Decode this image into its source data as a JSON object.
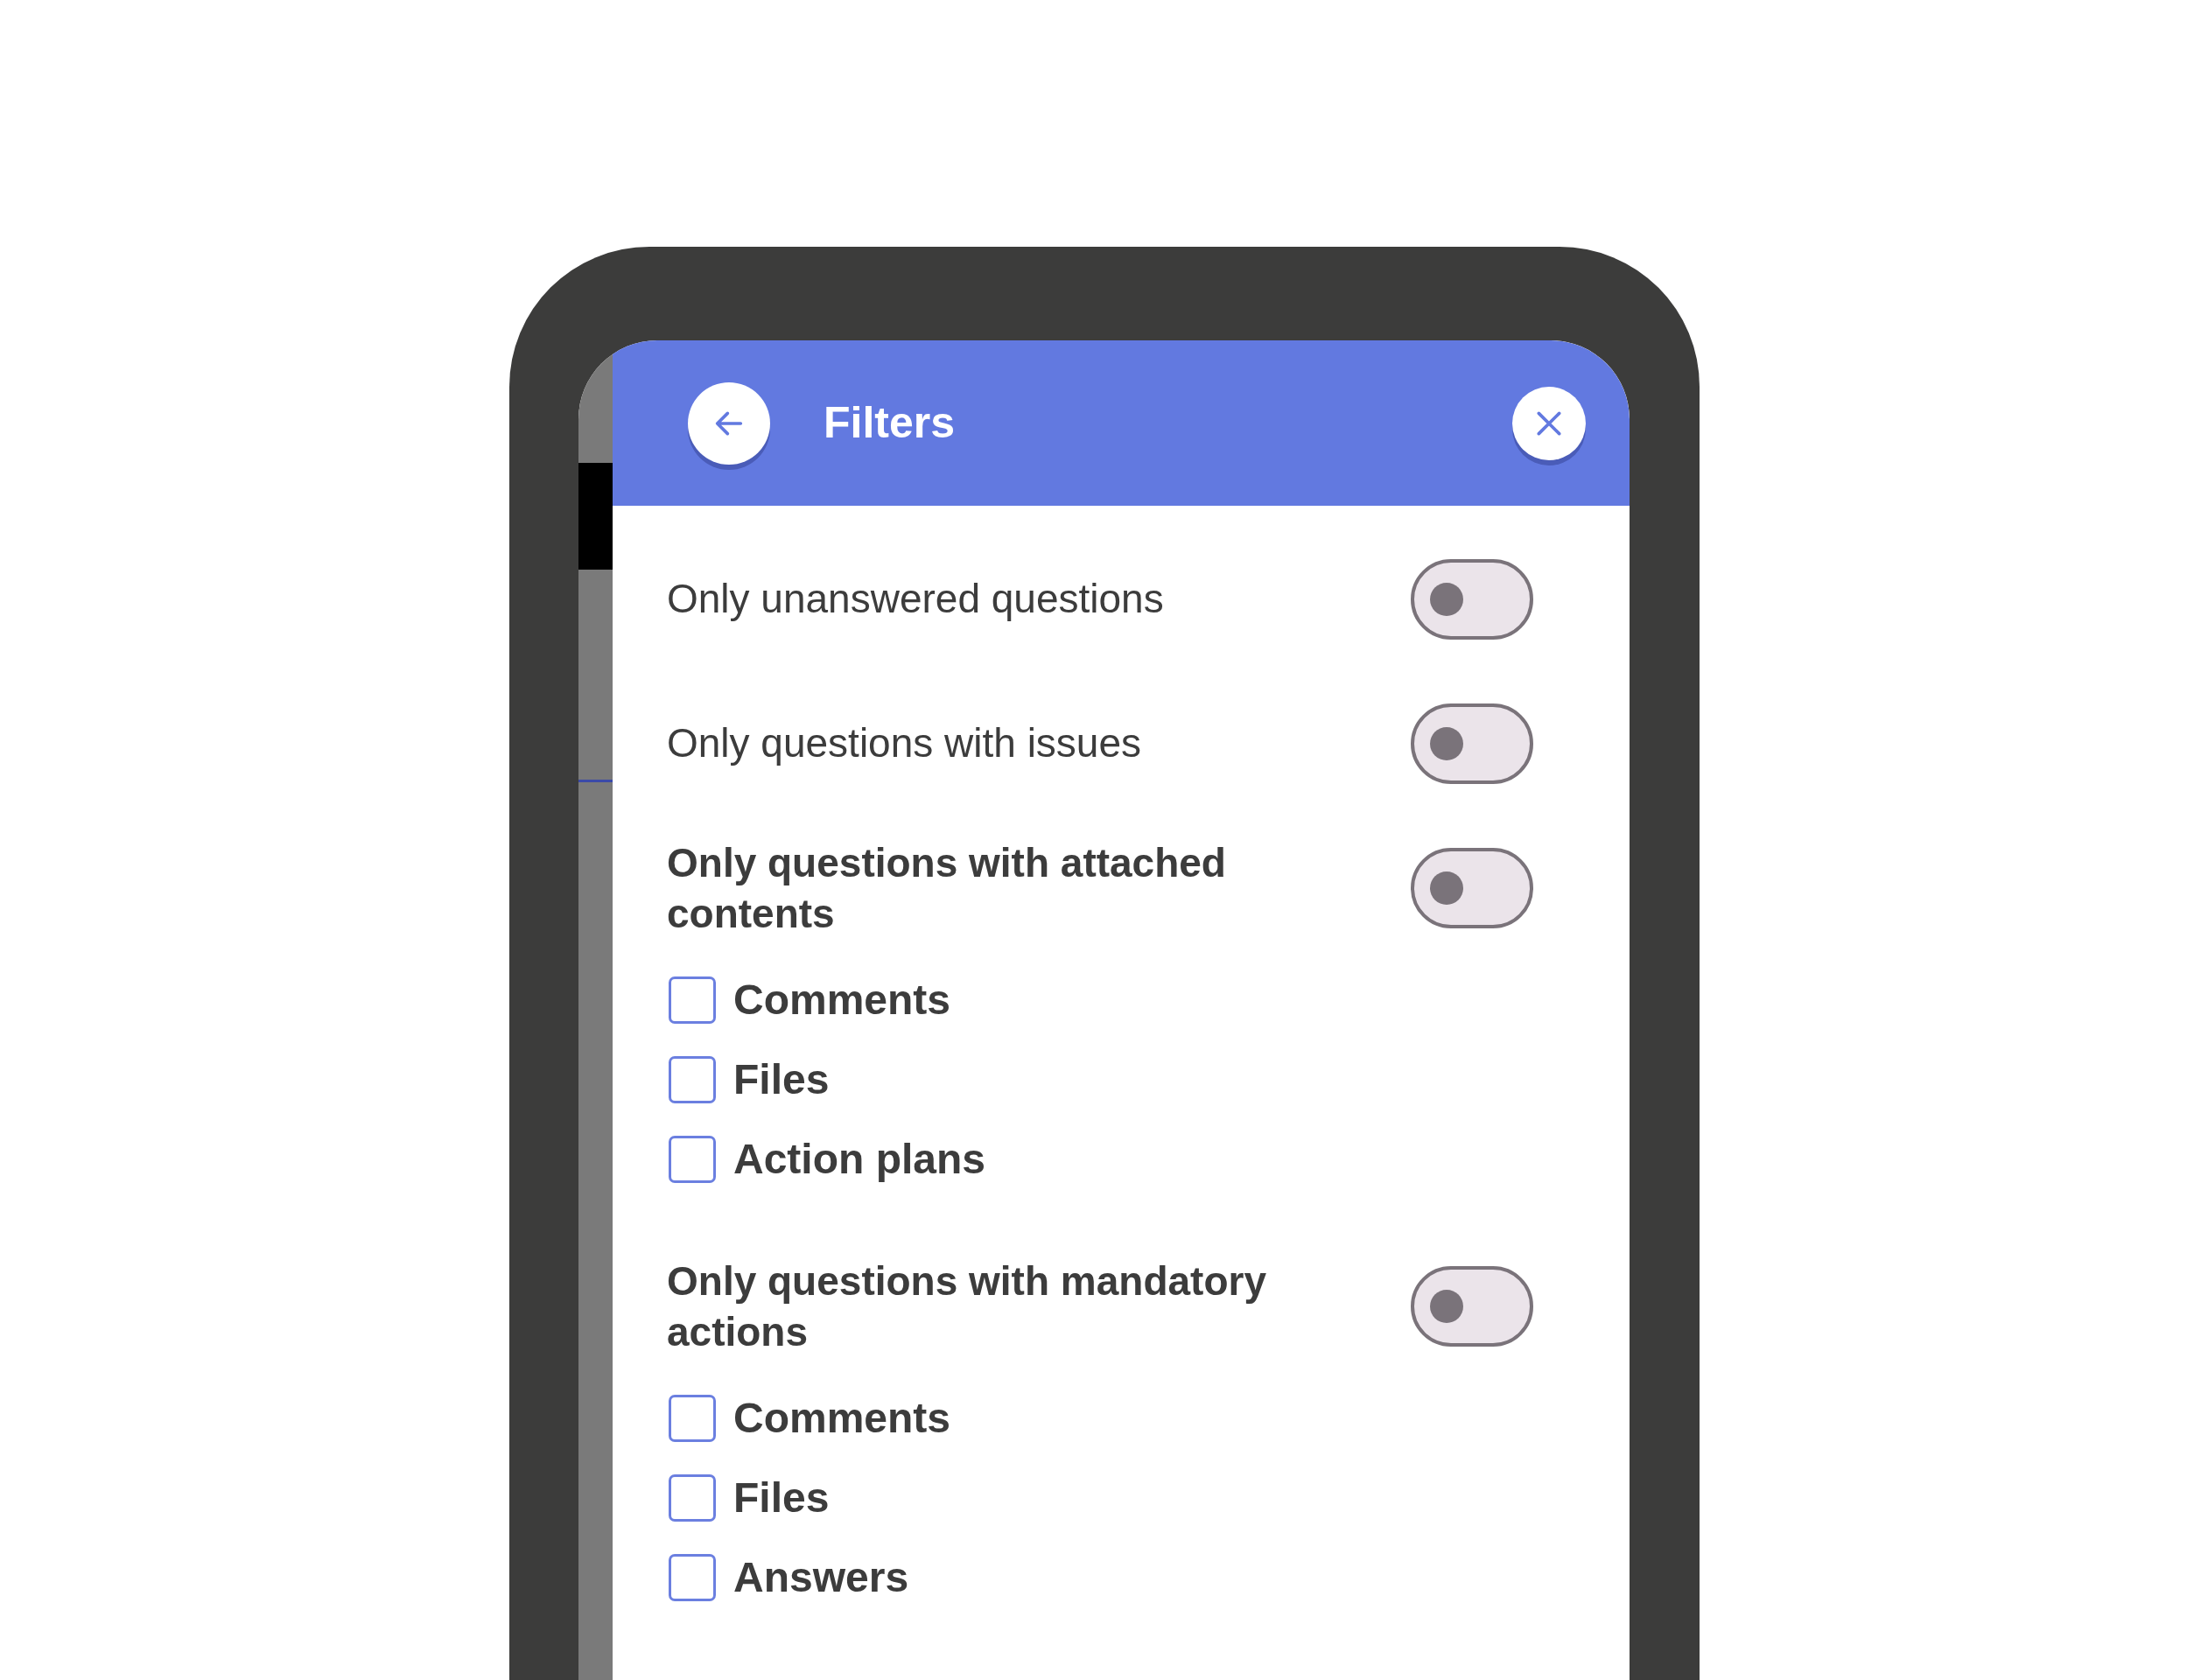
{
  "header": {
    "title": "Filters"
  },
  "filters": [
    {
      "kind": "toggle",
      "label": "Only unanswered questions",
      "on": false
    },
    {
      "kind": "toggle",
      "label": "Only questions with issues",
      "on": false
    },
    {
      "kind": "section",
      "label": "Only questions with attached contents",
      "on": false,
      "options": [
        {
          "label": "Comments",
          "checked": false
        },
        {
          "label": "Files",
          "checked": false
        },
        {
          "label": "Action plans",
          "checked": false
        }
      ]
    },
    {
      "kind": "section",
      "label": "Only questions with mandatory actions",
      "on": false,
      "options": [
        {
          "label": "Comments",
          "checked": false
        },
        {
          "label": "Files",
          "checked": false
        },
        {
          "label": "Answers",
          "checked": false
        }
      ]
    }
  ]
}
